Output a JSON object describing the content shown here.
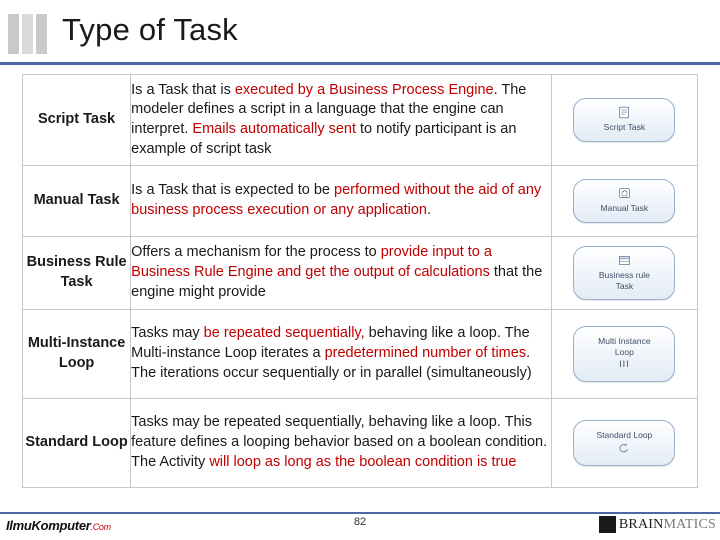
{
  "header": {
    "title": "Type of Task",
    "accent_color": "#4a6aa5"
  },
  "highlight_color": "#c00000",
  "rows": [
    {
      "label": "Script Task",
      "description_parts": [
        {
          "text": "Is a Task that is ",
          "hl": false
        },
        {
          "text": "executed by a Business Process Engine",
          "hl": true
        },
        {
          "text": ". The modeler defines a script in a language that the engine can interpret. ",
          "hl": false
        },
        {
          "text": "Emails automatically sent",
          "hl": true
        },
        {
          "text": " to notify participant is an example of script task",
          "hl": false
        }
      ],
      "icon": {
        "name": "script-task-icon",
        "label": "Script Task",
        "glyph": "document-gear"
      }
    },
    {
      "label": "Manual Task",
      "description_parts": [
        {
          "text": "Is a Task that is expected to be ",
          "hl": false
        },
        {
          "text": "performed without the aid of any business process execution or any application",
          "hl": true
        },
        {
          "text": ".",
          "hl": false
        }
      ],
      "icon": {
        "name": "manual-task-icon",
        "label": "Manual Task",
        "glyph": "hand"
      }
    },
    {
      "label": "Business Rule Task",
      "description_parts": [
        {
          "text": "Offers a mechanism for the process to ",
          "hl": false
        },
        {
          "text": "provide input to a Business Rule Engine and get the output of calculations",
          "hl": true
        },
        {
          "text": " that the engine might provide",
          "hl": false
        }
      ],
      "icon": {
        "name": "business-rule-task-icon",
        "label": "Business rule\nTask",
        "glyph": "table"
      }
    },
    {
      "label": "Multi-Instance Loop",
      "description_parts": [
        {
          "text": "Tasks may ",
          "hl": false
        },
        {
          "text": "be repeated sequentially,",
          "hl": true
        },
        {
          "text": "  behaving like a loop. The Multi-instance Loop iterates a ",
          "hl": false
        },
        {
          "text": "predetermined number of times",
          "hl": true
        },
        {
          "text": ".  The iterations occur sequentially or in parallel (simultaneously)",
          "hl": false
        }
      ],
      "icon": {
        "name": "multi-instance-loop-icon",
        "label": "Multi Instance\nLoop",
        "glyph": "bars",
        "bars": "III"
      }
    },
    {
      "label": "Standard Loop",
      "description_parts": [
        {
          "text": "Tasks may be repeated sequentially, behaving like a loop. This feature  defines a looping behavior based on a boolean condition. The Activity ",
          "hl": false
        },
        {
          "text": "will loop as long as the boolean condition is true",
          "hl": true
        }
      ],
      "icon": {
        "name": "standard-loop-icon",
        "label": "Standard Loop",
        "glyph": "loop-arrow"
      }
    }
  ],
  "footer": {
    "slide_number": "82",
    "logo_left_main": "IlmuKomputer",
    "logo_left_accent": ".Com",
    "logo_right_bold": "BRAIN",
    "logo_right_thin": "MATICS"
  }
}
